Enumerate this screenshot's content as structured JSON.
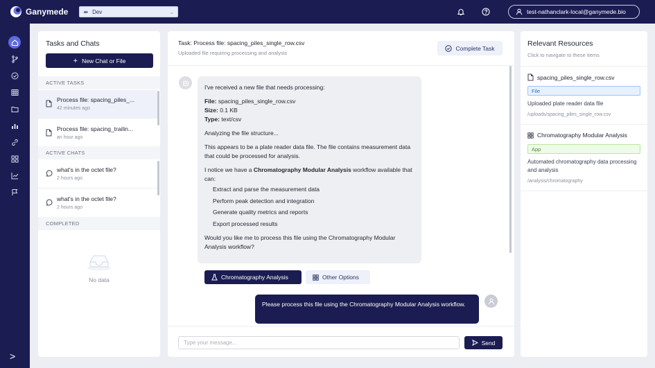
{
  "app": {
    "name": "Ganymede",
    "environment": "Dev",
    "user": "test-nathanclark-local@ganymede.bio"
  },
  "tasks_panel": {
    "title": "Tasks and Chats",
    "new_button": "New Chat or File",
    "sections": {
      "active_tasks": "ACTIVE TASKS",
      "active_chats": "ACTIVE CHATS",
      "completed": "COMPLETED"
    },
    "active_tasks": [
      {
        "title": "Process file: spacing_piles_...",
        "time": "42 minutes ago"
      },
      {
        "title": "Process file: spacing_trailin...",
        "time": "an hour ago"
      }
    ],
    "active_chats": [
      {
        "title": "what's in the octet file?",
        "time": "2 hours ago"
      },
      {
        "title": "what's in the octet file?",
        "time": "2 hours ago"
      }
    ],
    "empty_text": "No data"
  },
  "chat": {
    "task_title": "Task: Process file: spacing_piles_single_row.csv",
    "task_subtitle": "Uploaded file requiring processing and analysis",
    "complete_button": "Complete Task",
    "assistant_message": {
      "intro": "I've received a new file that needs processing:",
      "file_label": "File:",
      "file_value": " spacing_piles_single_row.csv",
      "size_label": "Size:",
      "size_value": " 0.1 KB",
      "type_label": "Type:",
      "type_value": " text/csv",
      "analyzing": "Analyzing the file structure...",
      "appears": "This appears to be a plate reader data file. The file contains measurement data that could be processed for analysis.",
      "notice_pre": "I notice we have a ",
      "notice_bold": "Chromatography Modular Analysis",
      "notice_post": " workflow available that can:",
      "capabilities": [
        "Extract and parse the measurement data",
        "Perform peak detection and integration",
        "Generate quality metrics and reports",
        "Export processed results"
      ],
      "question": "Would you like me to process this file using the Chromatography Modular Analysis workflow?"
    },
    "action_primary": "Chromatography Analysis",
    "action_secondary": "Other Options",
    "user_message": "Please process this file using the Chromatography Modular Analysis workflow.",
    "input_placeholder": "Type your message...",
    "send_button": "Send"
  },
  "resources": {
    "title": "Relevant Resources",
    "subtitle": "Click to navigate to these items",
    "items": [
      {
        "name": "spacing_piles_single_row.csv",
        "badge": "File",
        "description": "Uploaded plate reader data file",
        "path": "/uploads/spacing_piles_single_row.csv"
      },
      {
        "name": "Chromatography Modular Analysis",
        "badge": "App",
        "description": "Automated chromatography data processing and analysis",
        "path": "/analysis/chromatography"
      }
    ]
  },
  "colors": {
    "navy": "#1b1c52",
    "accent": "#5f6ae0",
    "file_badge": "#2f6fc7",
    "app_badge": "#4a8f2a"
  }
}
